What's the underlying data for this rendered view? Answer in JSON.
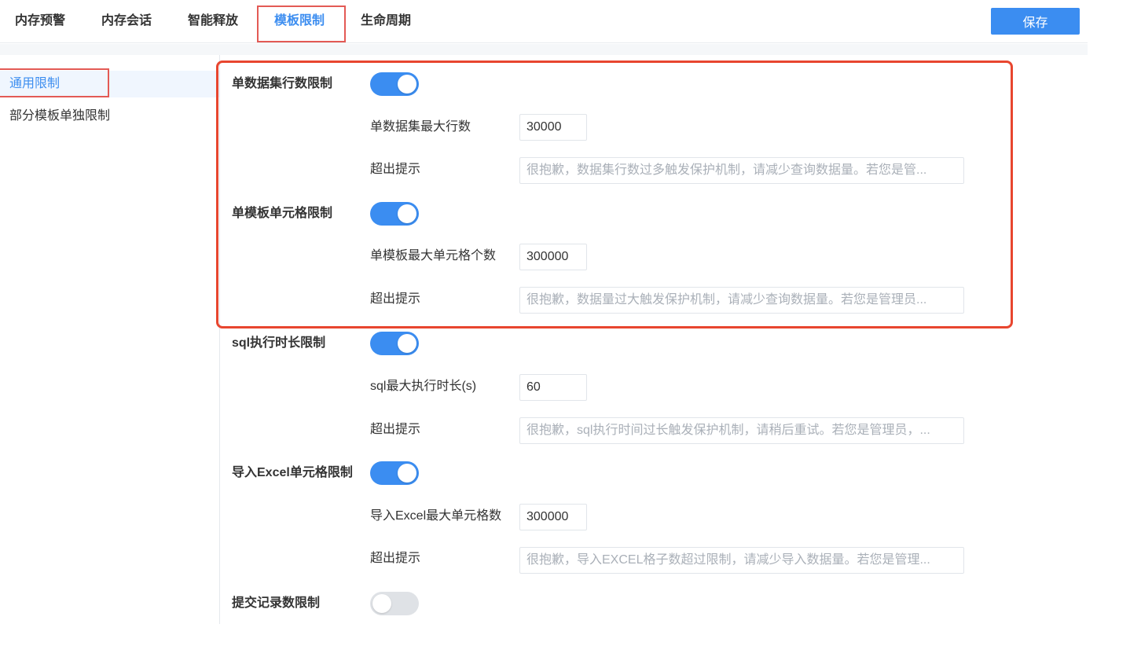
{
  "tabs": [
    {
      "label": "内存预警"
    },
    {
      "label": "内存会话"
    },
    {
      "label": "智能释放"
    },
    {
      "label": "模板限制"
    },
    {
      "label": "生命周期"
    }
  ],
  "save_label": "保存",
  "sidebar": {
    "items": [
      {
        "label": "通用限制"
      },
      {
        "label": "部分模板单独限制"
      }
    ]
  },
  "groups": [
    {
      "label": "单数据集行数限制",
      "enabled": true,
      "max_label": "单数据集最大行数",
      "max_value": "30000",
      "hint_label": "超出提示",
      "hint_placeholder": "很抱歉，数据集行数过多触发保护机制，请减少查询数据量。若您是管..."
    },
    {
      "label": "单模板单元格限制",
      "enabled": true,
      "max_label": "单模板最大单元格个数",
      "max_value": "300000",
      "hint_label": "超出提示",
      "hint_placeholder": "很抱歉，数据量过大触发保护机制，请减少查询数据量。若您是管理员..."
    },
    {
      "label": "sql执行时长限制",
      "enabled": true,
      "max_label": "sql最大执行时长(s)",
      "max_value": "60",
      "hint_label": "超出提示",
      "hint_placeholder": "很抱歉，sql执行时间过长触发保护机制，请稍后重试。若您是管理员，..."
    },
    {
      "label": "导入Excel单元格限制",
      "enabled": true,
      "max_label": "导入Excel最大单元格数",
      "max_value": "300000",
      "hint_label": "超出提示",
      "hint_placeholder": "很抱歉，导入EXCEL格子数超过限制，请减少导入数据量。若您是管理..."
    },
    {
      "label": "提交记录数限制",
      "enabled": false
    }
  ],
  "colors": {
    "accent": "#3b8df1",
    "highlight_red": "#e35a55",
    "focus_red": "#e8462f"
  }
}
